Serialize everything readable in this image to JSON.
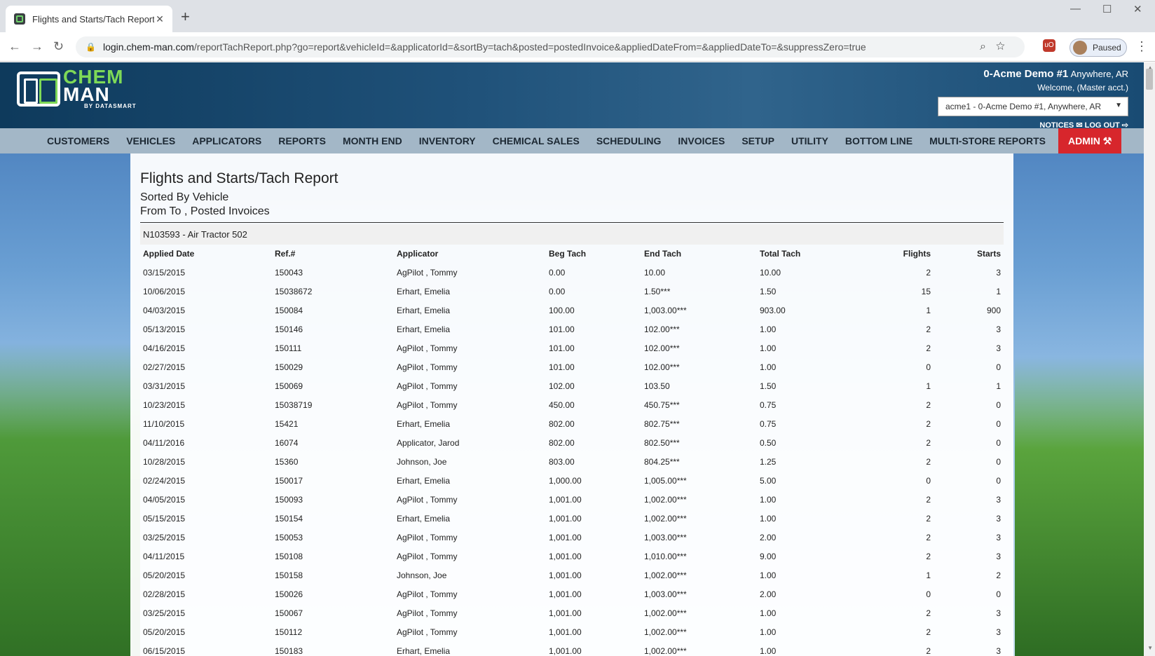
{
  "browser": {
    "tab_title": "Flights and Starts/Tach Report - C",
    "tab_close": "✕",
    "new_tab": "+",
    "url_host": "login.chem-man.com",
    "url_path": "/reportTachReport.php?go=report&vehicleId=&applicatorId=&sortBy=tach&posted=postedInvoice&appliedDateFrom=&appliedDateTo=&suppressZero=true",
    "profile_label": "Paused",
    "win_min": "—",
    "win_max": "☐",
    "win_close": "✕"
  },
  "logo": {
    "line1": "CHEM",
    "line2": "MAN",
    "line3": "BY DATASMART"
  },
  "account": {
    "name": "0-Acme Demo #1",
    "location": "Anywhere, AR",
    "welcome": "Welcome, (Master acct.)",
    "selected": "acme1 - 0-Acme Demo #1, Anywhere, AR",
    "notices": "NOTICES ✉",
    "logout": "LOG OUT ⇨"
  },
  "nav": {
    "customers": "CUSTOMERS",
    "vehicles": "VEHICLES",
    "applicators": "APPLICATORS",
    "reports": "REPORTS",
    "month_end": "MONTH END",
    "inventory": "INVENTORY",
    "chemical_sales": "CHEMICAL SALES",
    "scheduling": "SCHEDULING",
    "invoices": "INVOICES",
    "setup": "SETUP",
    "utility": "UTILITY",
    "bottom_line": "BOTTOM LINE",
    "multi_store": "MULTI-STORE REPORTS",
    "admin": "ADMIN"
  },
  "report": {
    "title": "Flights and Starts/Tach Report",
    "sorted_by": "Sorted By Vehicle",
    "range": "From To , Posted Invoices",
    "vehicle": "N103593 - Air Tractor 502",
    "columns": {
      "applied_date": "Applied Date",
      "ref": "Ref.#",
      "applicator": "Applicator",
      "beg_tach": "Beg Tach",
      "end_tach": "End Tach",
      "total_tach": "Total Tach",
      "flights": "Flights",
      "starts": "Starts"
    },
    "rows": [
      {
        "date": "03/15/2015",
        "ref": "150043",
        "applicator": "AgPilot , Tommy",
        "beg": "0.00",
        "end": "10.00",
        "total": "10.00",
        "flights": "2",
        "starts": "3"
      },
      {
        "date": "10/06/2015",
        "ref": "15038672",
        "applicator": "Erhart, Emelia",
        "beg": "0.00",
        "end": "1.50***",
        "total": "1.50",
        "flights": "15",
        "starts": "1"
      },
      {
        "date": "04/03/2015",
        "ref": "150084",
        "applicator": "Erhart, Emelia",
        "beg": "100.00",
        "end": "1,003.00***",
        "total": "903.00",
        "flights": "1",
        "starts": "900"
      },
      {
        "date": "05/13/2015",
        "ref": "150146",
        "applicator": "Erhart, Emelia",
        "beg": "101.00",
        "end": "102.00***",
        "total": "1.00",
        "flights": "2",
        "starts": "3"
      },
      {
        "date": "04/16/2015",
        "ref": "150111",
        "applicator": "AgPilot , Tommy",
        "beg": "101.00",
        "end": "102.00***",
        "total": "1.00",
        "flights": "2",
        "starts": "3"
      },
      {
        "date": "02/27/2015",
        "ref": "150029",
        "applicator": "AgPilot , Tommy",
        "beg": "101.00",
        "end": "102.00***",
        "total": "1.00",
        "flights": "0",
        "starts": "0"
      },
      {
        "date": "03/31/2015",
        "ref": "150069",
        "applicator": "AgPilot , Tommy",
        "beg": "102.00",
        "end": "103.50",
        "total": "1.50",
        "flights": "1",
        "starts": "1"
      },
      {
        "date": "10/23/2015",
        "ref": "15038719",
        "applicator": "AgPilot , Tommy",
        "beg": "450.00",
        "end": "450.75***",
        "total": "0.75",
        "flights": "2",
        "starts": "0"
      },
      {
        "date": "11/10/2015",
        "ref": "15421",
        "applicator": "Erhart, Emelia",
        "beg": "802.00",
        "end": "802.75***",
        "total": "0.75",
        "flights": "2",
        "starts": "0"
      },
      {
        "date": "04/11/2016",
        "ref": "16074",
        "applicator": "Applicator, Jarod",
        "beg": "802.00",
        "end": "802.50***",
        "total": "0.50",
        "flights": "2",
        "starts": "0"
      },
      {
        "date": "10/28/2015",
        "ref": "15360",
        "applicator": "Johnson, Joe",
        "beg": "803.00",
        "end": "804.25***",
        "total": "1.25",
        "flights": "2",
        "starts": "0"
      },
      {
        "date": "02/24/2015",
        "ref": "150017",
        "applicator": "Erhart, Emelia",
        "beg": "1,000.00",
        "end": "1,005.00***",
        "total": "5.00",
        "flights": "0",
        "starts": "0"
      },
      {
        "date": "04/05/2015",
        "ref": "150093",
        "applicator": "AgPilot , Tommy",
        "beg": "1,001.00",
        "end": "1,002.00***",
        "total": "1.00",
        "flights": "2",
        "starts": "3"
      },
      {
        "date": "05/15/2015",
        "ref": "150154",
        "applicator": "Erhart, Emelia",
        "beg": "1,001.00",
        "end": "1,002.00***",
        "total": "1.00",
        "flights": "2",
        "starts": "3"
      },
      {
        "date": "03/25/2015",
        "ref": "150053",
        "applicator": "AgPilot , Tommy",
        "beg": "1,001.00",
        "end": "1,003.00***",
        "total": "2.00",
        "flights": "2",
        "starts": "3"
      },
      {
        "date": "04/11/2015",
        "ref": "150108",
        "applicator": "AgPilot , Tommy",
        "beg": "1,001.00",
        "end": "1,010.00***",
        "total": "9.00",
        "flights": "2",
        "starts": "3"
      },
      {
        "date": "05/20/2015",
        "ref": "150158",
        "applicator": "Johnson, Joe",
        "beg": "1,001.00",
        "end": "1,002.00***",
        "total": "1.00",
        "flights": "1",
        "starts": "2"
      },
      {
        "date": "02/28/2015",
        "ref": "150026",
        "applicator": "AgPilot , Tommy",
        "beg": "1,001.00",
        "end": "1,003.00***",
        "total": "2.00",
        "flights": "0",
        "starts": "0"
      },
      {
        "date": "03/25/2015",
        "ref": "150067",
        "applicator": "AgPilot , Tommy",
        "beg": "1,001.00",
        "end": "1,002.00***",
        "total": "1.00",
        "flights": "2",
        "starts": "3"
      },
      {
        "date": "05/20/2015",
        "ref": "150112",
        "applicator": "AgPilot , Tommy",
        "beg": "1,001.00",
        "end": "1,002.00***",
        "total": "1.00",
        "flights": "2",
        "starts": "3"
      },
      {
        "date": "06/15/2015",
        "ref": "150183",
        "applicator": "Erhart, Emelia",
        "beg": "1,001.00",
        "end": "1,002.00***",
        "total": "1.00",
        "flights": "2",
        "starts": "3"
      }
    ]
  },
  "colors": {
    "admin": "#d7262c",
    "logo_green": "#7ed957",
    "nav_bg": "#a3b7c7"
  }
}
